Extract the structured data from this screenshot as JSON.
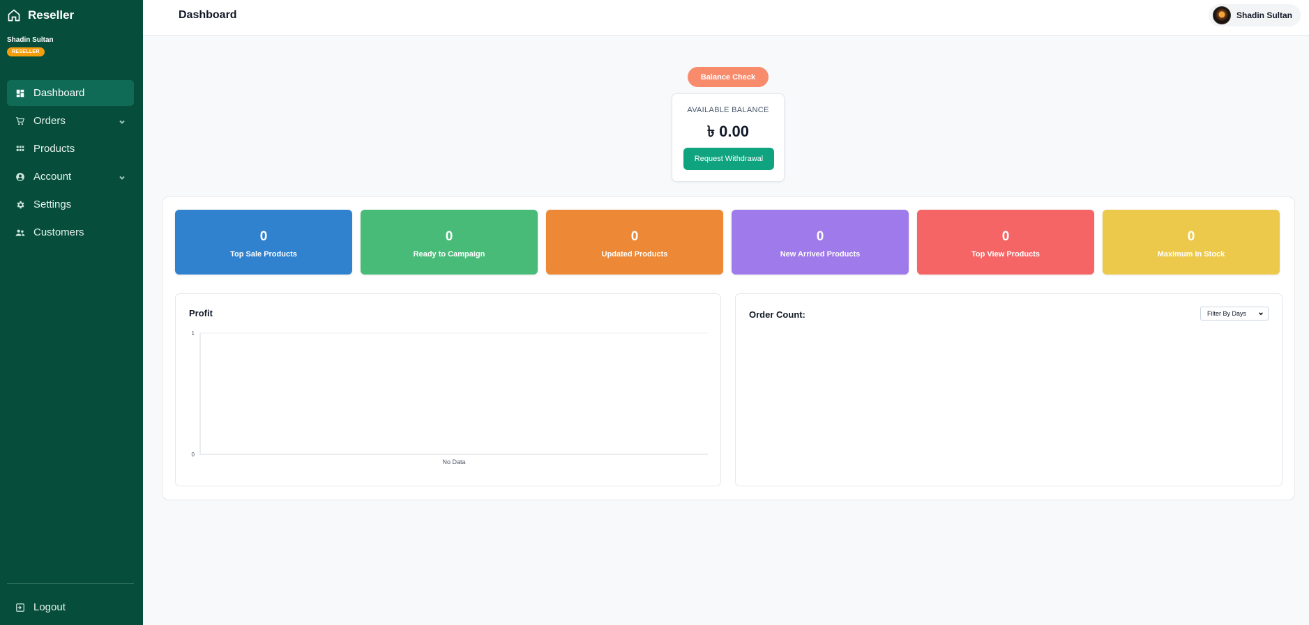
{
  "sidebar": {
    "brand": "Reseller",
    "user_name": "Shadin Sultan",
    "role": "RESELLER",
    "items": [
      {
        "label": "Dashboard",
        "icon": "dashboard-icon"
      },
      {
        "label": "Orders",
        "icon": "cart-icon"
      },
      {
        "label": "Products",
        "icon": "grid-icon"
      },
      {
        "label": "Account",
        "icon": "user-circle-icon"
      },
      {
        "label": "Settings",
        "icon": "gear-icon"
      },
      {
        "label": "Customers",
        "icon": "users-icon"
      }
    ],
    "logout": "Logout"
  },
  "header": {
    "title": "Dashboard",
    "user_name": "Shadin Sultan"
  },
  "balance": {
    "check_label": "Balance Check",
    "label": "AVAILABLE BALANCE",
    "value": "৳ 0.00",
    "withdraw_label": "Request Withdrawal"
  },
  "stats": [
    {
      "value": "0",
      "label": "Top Sale Products",
      "color": "#3182ce"
    },
    {
      "value": "0",
      "label": "Ready to Campaign",
      "color": "#48bb78"
    },
    {
      "value": "0",
      "label": "Updated Products",
      "color": "#ed8936"
    },
    {
      "value": "0",
      "label": "New Arrived Products",
      "color": "#9f7aea"
    },
    {
      "value": "0",
      "label": "Top View Products",
      "color": "#f56565"
    },
    {
      "value": "0",
      "label": "Maximum In Stock",
      "color": "#ecc94b"
    }
  ],
  "profit": {
    "title": "Profit"
  },
  "order_count": {
    "title": "Order Count:",
    "filter_value": "Filter By Days"
  },
  "chart_data": {
    "type": "line",
    "title": "Profit",
    "categories": [
      "No Data"
    ],
    "series": [
      {
        "values": []
      }
    ],
    "ylim": [
      0,
      1
    ],
    "yticks": [
      "1",
      "0"
    ],
    "grid": false
  }
}
